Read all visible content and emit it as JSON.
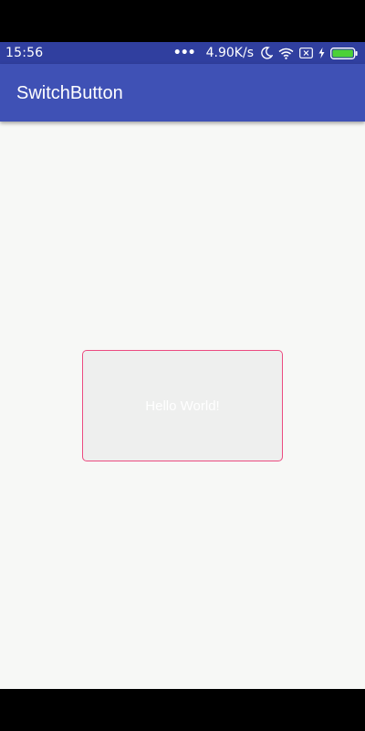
{
  "status_bar": {
    "time": "15:56",
    "more_dots": "•••",
    "network_speed": "4.90K/s",
    "icons": [
      "moon-icon",
      "wifi-icon",
      "sim-off-icon",
      "charging-icon",
      "battery-icon"
    ],
    "background_color": "#303F9F"
  },
  "app_bar": {
    "title": "SwitchButton",
    "background_color": "#3F51B5"
  },
  "content": {
    "background_color": "#F7F8F6",
    "switch_button": {
      "label": "Hello World!",
      "border_color": "#EC4B80",
      "fill_color": "#EEEFEE"
    }
  }
}
